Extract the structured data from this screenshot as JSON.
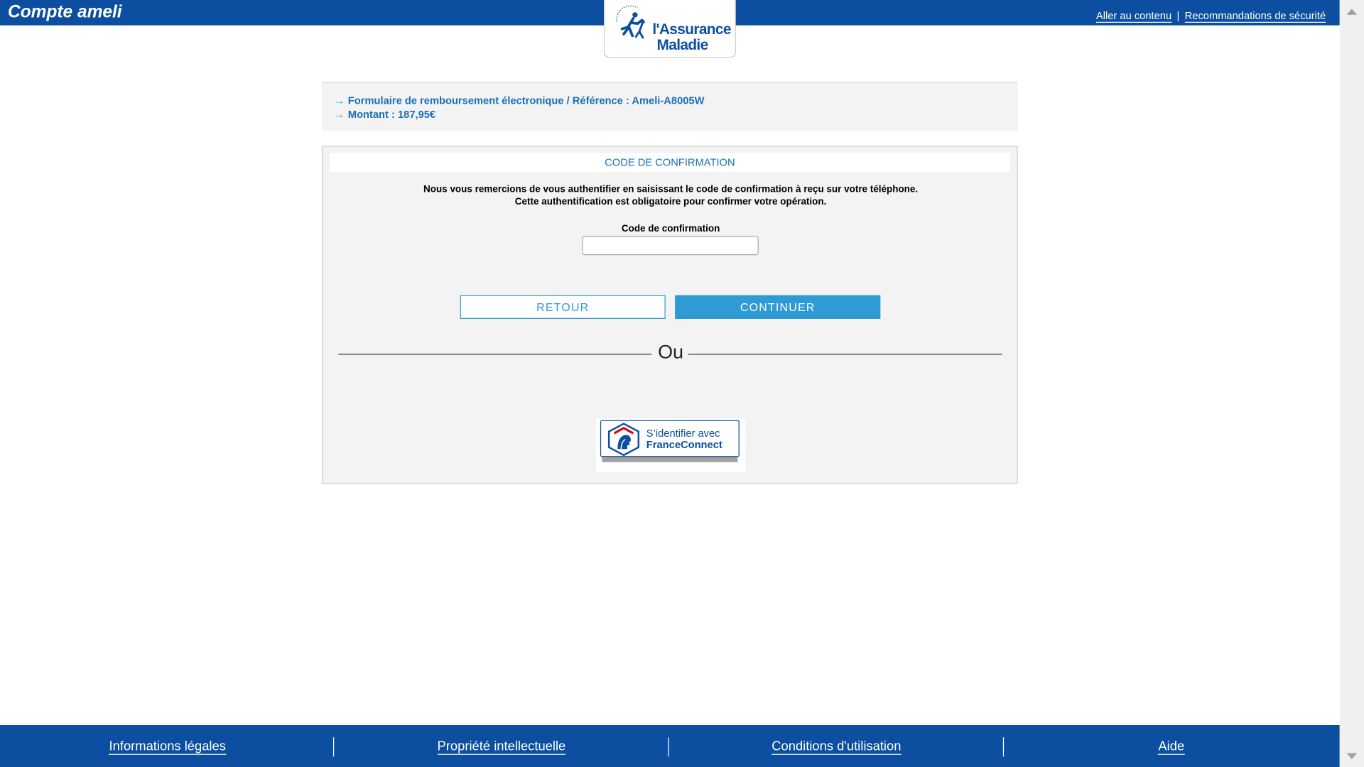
{
  "header": {
    "brand": "Compte ameli",
    "links": {
      "skip": "Aller au contenu",
      "separator": "|",
      "security": "Recommandations de sécurité"
    },
    "logo": {
      "line1": "l'Assurance",
      "line2": "Maladie",
      "icon": "assurance-maladie-logo-icon"
    }
  },
  "info": {
    "arrow": "→",
    "reference": "Formulaire de remboursement électronique / Référence : Ameli-A8005W",
    "amount": "Montant : 187,95€"
  },
  "form": {
    "title": "CODE DE CONFIRMATION",
    "message_line1": "Nous vous remercions de vous authentifier en saisissant le code de confirmation à reçu sur votre téléphone.",
    "message_line2": "Cette authentification est obligatoire pour confirmer votre opération.",
    "field_label": "Code de confirmation",
    "field_value": "",
    "back_label": "RETOUR",
    "continue_label": "CONTINUER",
    "or_label": "Ou",
    "franceconnect": {
      "line1": "S’identifier avec",
      "line2": "FranceConnect",
      "icon": "franceconnect-logo-icon"
    }
  },
  "footer": {
    "items": [
      "Informations légales",
      "Propriété intellectuelle",
      "Conditions d'utilisation",
      "Aide"
    ]
  },
  "colors": {
    "brand_blue": "#0c4fa0",
    "accent_blue": "#2f9bd4",
    "link_blue": "#1a6fb5",
    "panel_bg": "#f3f3f3"
  }
}
